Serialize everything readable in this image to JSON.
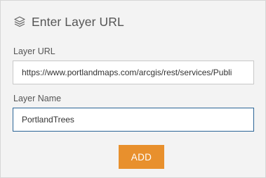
{
  "panel": {
    "title": "Enter Layer URL",
    "header_icon": "layers-icon"
  },
  "layer_url": {
    "label": "Layer URL",
    "value": "https://www.portlandmaps.com/arcgis/rest/services/Publi"
  },
  "layer_name": {
    "label": "Layer Name",
    "value": "PortlandTrees"
  },
  "actions": {
    "add_label": "ADD"
  },
  "colors": {
    "accent": "#e8902d",
    "panel_bg": "#f3f3f3",
    "focus_border": "#2a6496"
  }
}
